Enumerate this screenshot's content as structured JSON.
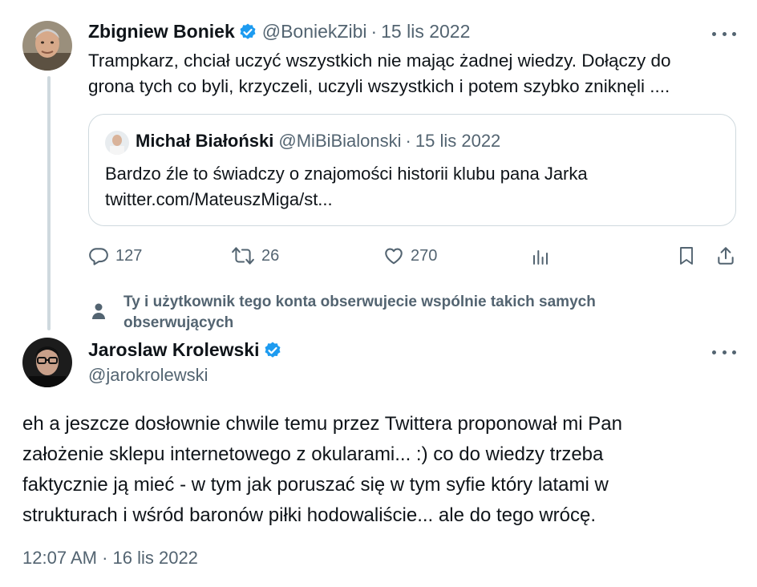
{
  "tweet1": {
    "name": "Zbigniew Boniek",
    "handle": "@BoniekZibi",
    "separator": "·",
    "date": "15 lis 2022",
    "text_lines": [
      "Trampkarz, chciał uczyć wszystkich nie mając żadnej wiedzy. Dołączy do",
      "grona tych co byli, krzyczeli, uczyli wszystkich i potem szybko zniknęli ...."
    ],
    "quote": {
      "name": "Michał Białoński",
      "handle": "@MiBiBialonski",
      "separator": "·",
      "date": "15 lis 2022",
      "text_lines": [
        "Bardzo źle to świadczy o znajomości historii klubu pana Jarka",
        "twitter.com/MateuszMiga/st..."
      ]
    },
    "actions": {
      "replies": "127",
      "retweets": "26",
      "likes": "270"
    }
  },
  "social_context": {
    "text": "Ty i użytkownik tego konta obserwujecie wspólnie takich samych obserwujących"
  },
  "tweet2": {
    "name": "Jaroslaw Krolewski",
    "handle": "@jarokrolewski",
    "text_lines": [
      "eh a jeszcze dosłownie chwile temu przez Twittera proponował mi Pan",
      "założenie sklepu internetowego z okularami... :) co do wiedzy trzeba",
      "faktycznie ją mieć - w tym jak poruszać się w tym syfie który latami w",
      "strukturach i wśród baronów piłki hodowaliście... ale do tego wrócę."
    ],
    "timestamp": "12:07 AM · 16 lis 2022"
  },
  "colors": {
    "verified": "#1d9bf0",
    "secondary_text": "#536471",
    "border": "#cfd9de"
  },
  "icons": [
    "verified-badge-icon",
    "more-icon",
    "reply-icon",
    "retweet-icon",
    "like-icon",
    "views-icon",
    "bookmark-icon",
    "share-icon",
    "person-icon"
  ]
}
